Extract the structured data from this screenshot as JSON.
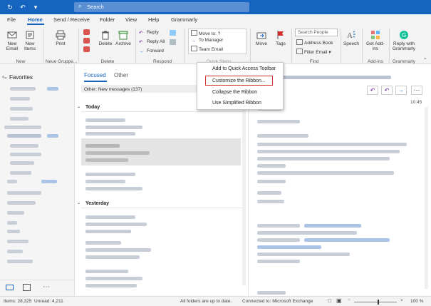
{
  "titlebar": {
    "search_placeholder": "Search"
  },
  "menu": {
    "tabs": [
      "File",
      "Home",
      "Send / Receive",
      "Folder",
      "View",
      "Help",
      "Grammarly"
    ],
    "active": "Home"
  },
  "ribbon": {
    "new_email": "New Email",
    "new_items": "New Items",
    "print": "Print",
    "delete": "Delete",
    "archive": "Archive",
    "reply": "Reply",
    "reply_all": "Reply All",
    "forward": "Forward",
    "quick_steps": [
      "Move to: ?",
      "To Manager",
      "Team Email"
    ],
    "quick_steps_label": "Quick Steps",
    "move": "Move",
    "tags": "Tags",
    "search_people": "Search People",
    "address_book": "Address Book",
    "filter_email": "Filter Email",
    "speech": "Speech",
    "get_addins": "Get Add-ins",
    "reply_grammarly": "Reply with Grammarly",
    "groups": {
      "new": "New",
      "neue": "Neue Gruppe...",
      "delete": "Delete",
      "respond": "Respond",
      "find": "Find",
      "addins": "Add-ins",
      "grammarly": "Grammarly"
    }
  },
  "context_menu": {
    "items": [
      "Add to Quick Access Toolbar",
      "Customize the Ribbon...",
      "Collapse the Ribbon",
      "Use Simplified Ribbon"
    ],
    "highlighted_index": 1
  },
  "leftnav": {
    "favorites": "Favorites"
  },
  "msglist": {
    "focused": "Focused",
    "other": "Other",
    "banner": "Other: New messages (137)",
    "today": "Today",
    "yesterday": "Yesterday"
  },
  "readpane": {
    "time": "10:45"
  },
  "status": {
    "items": "Items: 28,325",
    "unread": "Unread: 4,211",
    "sync": "All folders are up to date.",
    "connection": "Connected to: Microsoft Exchange",
    "zoom": "100 %"
  },
  "colors": {
    "accent": "#1565c0",
    "highlight": "#d32f2f"
  }
}
